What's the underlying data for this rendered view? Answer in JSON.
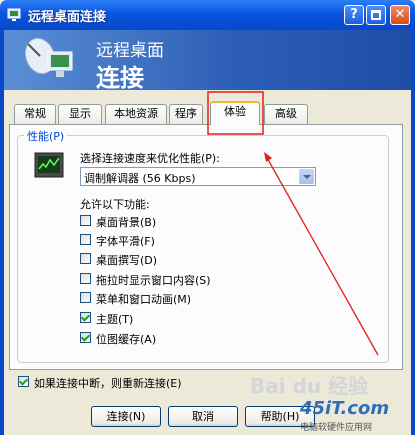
{
  "window": {
    "title": "远程桌面连接",
    "help": "?",
    "close": "✕"
  },
  "banner": {
    "line1": "远程桌面",
    "line2": "连接"
  },
  "tabs": [
    "常规",
    "显示",
    "本地资源",
    "程序",
    "体验",
    "高级"
  ],
  "active_tab": "体验",
  "performance": {
    "group_label": "性能(P)",
    "choose_label": "选择连接速度来优化性能(P):",
    "speed_value": "调制解调器 (56 Kbps)",
    "allow_label": "允许以下功能:",
    "options": [
      {
        "label": "桌面背景(B)",
        "checked": false
      },
      {
        "label": "字体平滑(F)",
        "checked": false
      },
      {
        "label": "桌面撰写(D)",
        "checked": false
      },
      {
        "label": "拖拉时显示窗口内容(S)",
        "checked": false
      },
      {
        "label": "菜单和窗口动画(M)",
        "checked": false
      },
      {
        "label": "主题(T)",
        "checked": true
      },
      {
        "label": "位图缓存(A)",
        "checked": true
      }
    ]
  },
  "reconnect": {
    "label": "如果连接中断，则重新连接(E)",
    "checked": true
  },
  "buttons": {
    "connect": "连接(N)",
    "cancel": "取消",
    "help": "帮助(H)"
  },
  "watermarks": {
    "baidu": "Bai du 经验",
    "site": "45iT.com",
    "site_sub": "电脑软硬件应用网"
  },
  "colors": {
    "highlight": "#e0201c",
    "accent": "#0046d5",
    "title_bar": "#0a55e0"
  }
}
